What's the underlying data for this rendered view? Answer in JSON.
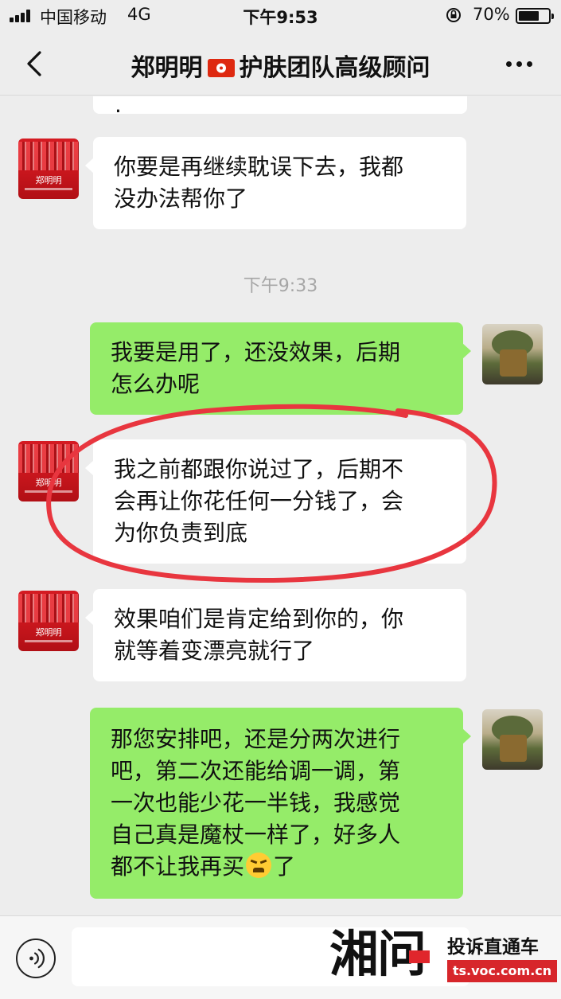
{
  "status_bar": {
    "carrier": "中国移动",
    "network": "4G",
    "time": "下午9:53",
    "battery_percent": "70%",
    "battery_level": 0.7
  },
  "nav": {
    "title_name": "郑明明",
    "title_role": "护肤团队高级顾问",
    "back_icon": "chevron-left-icon",
    "more_icon": "more-dots-icon",
    "flag_icon": "hong-kong-flag-icon"
  },
  "messages": [
    {
      "side": "left",
      "lines": [
        "你要是再继续耽误下去，我都",
        "没办法帮你了"
      ]
    },
    {
      "type": "timestamp",
      "text": "下午9:33"
    },
    {
      "side": "right",
      "lines": [
        "我要是用了，还没效果，后期",
        "怎么办呢"
      ]
    },
    {
      "side": "left",
      "lines": [
        "我之前都跟你说过了，后期不",
        "会再让你花任何一分钱了，会",
        "为你负责到底"
      ],
      "highlighted": true
    },
    {
      "side": "left",
      "lines": [
        "效果咱们是肯定给到你的，你",
        "就等着变漂亮就行了"
      ]
    },
    {
      "side": "right",
      "lines": [
        "那您安排吧，还是分两次进行",
        "吧，第二次还能给调一调，第",
        "一次也能少花一半钱，我感觉",
        "自己真是魔杖一样了，好多人",
        "都不让我再买",
        "了"
      ],
      "emoji": "grimace-face-emoji"
    }
  ],
  "avatars": {
    "contact_label": "郑明明",
    "self": "user-avatar"
  },
  "input": {
    "voice_icon": "voice-icon",
    "placeholder": ""
  },
  "watermark": {
    "logo": "湘问",
    "slogan": "投诉直通车",
    "site": "ts.voc.com.cn"
  },
  "colors": {
    "background": "#ededed",
    "bubble_left": "#ffffff",
    "bubble_right": "#95ec69",
    "annotation": "#e8363f",
    "watermark_red": "#d7262b"
  }
}
